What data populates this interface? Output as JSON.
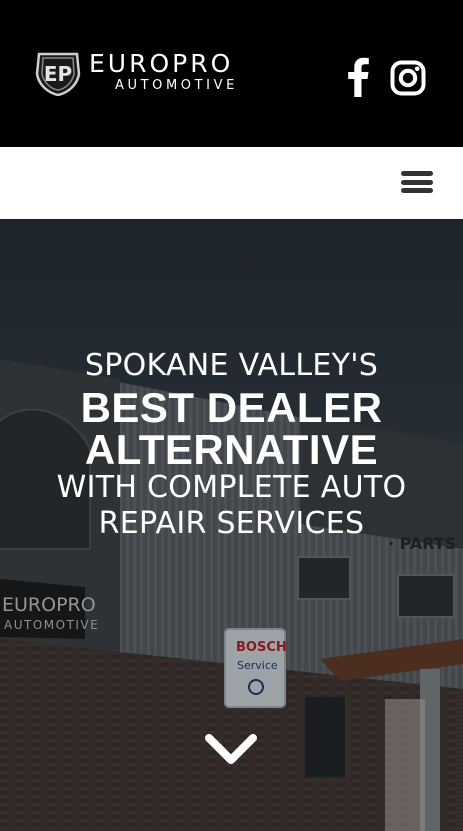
{
  "header": {
    "logo": {
      "wordmark": "EUROPRO",
      "subtitle": "AUTOMOTIVE",
      "badge_text": "EP"
    },
    "social": [
      {
        "name": "facebook",
        "icon": "facebook-icon"
      },
      {
        "name": "instagram",
        "icon": "instagram-icon"
      }
    ]
  },
  "nav": {
    "menu_icon": "hamburger-menu-icon"
  },
  "hero": {
    "line1": "SPOKANE VALLEY'S",
    "line2": "BEST DEALER",
    "line3": "ALTERNATIVE",
    "line4": "WITH COMPLETE AUTO",
    "line5": "REPAIR SERVICES",
    "scroll_icon": "chevron-down-icon",
    "building_sign": {
      "brand": "EUROPRO",
      "sub": "AUTOMOTIVE",
      "bosch": "BOSCH",
      "service": "Service",
      "parts": "· PARTS"
    }
  },
  "colors": {
    "header_bg": "#000000",
    "nav_bg": "#ffffff",
    "hamburger": "#333333",
    "hero_text": "#ffffff"
  }
}
